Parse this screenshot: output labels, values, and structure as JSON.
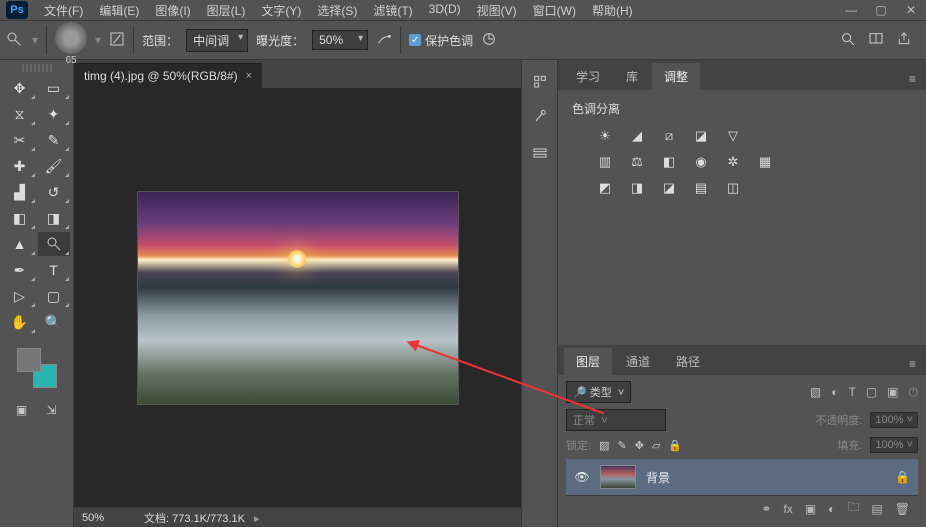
{
  "app_logo": "Ps",
  "menu": {
    "file": "文件(F)",
    "edit": "编辑(E)",
    "image": "图像(I)",
    "layer": "图层(L)",
    "type": "文字(Y)",
    "select": "选择(S)",
    "filter": "滤镜(T)",
    "three_d": "3D(D)",
    "view": "视图(V)",
    "window": "窗口(W)",
    "help": "帮助(H)"
  },
  "options": {
    "brush_size": "65",
    "range_label": "范围：",
    "range_value": "中间调",
    "exposure_label": "曝光度：",
    "exposure_value": "50%",
    "protect_tone": "保护色调"
  },
  "document": {
    "tab_title": "timg (4).jpg @ 50%(RGB/8#)",
    "zoom": "50%",
    "status_label": "文档:",
    "status_value": "773.1K/773.1K"
  },
  "panel1": {
    "tabs": {
      "learn": "学习",
      "library": "库",
      "adjust": "调整"
    },
    "title": "色调分离"
  },
  "panel2": {
    "tabs": {
      "layers": "图层",
      "channels": "通道",
      "paths": "路径"
    },
    "kind_label": "类型",
    "mode": "正常",
    "opacity_label": "不透明度:",
    "opacity_value": "100%",
    "lock_label": "锁定:",
    "fill_label": "填充:",
    "fill_value": "100%",
    "bg_layer": "背景"
  }
}
